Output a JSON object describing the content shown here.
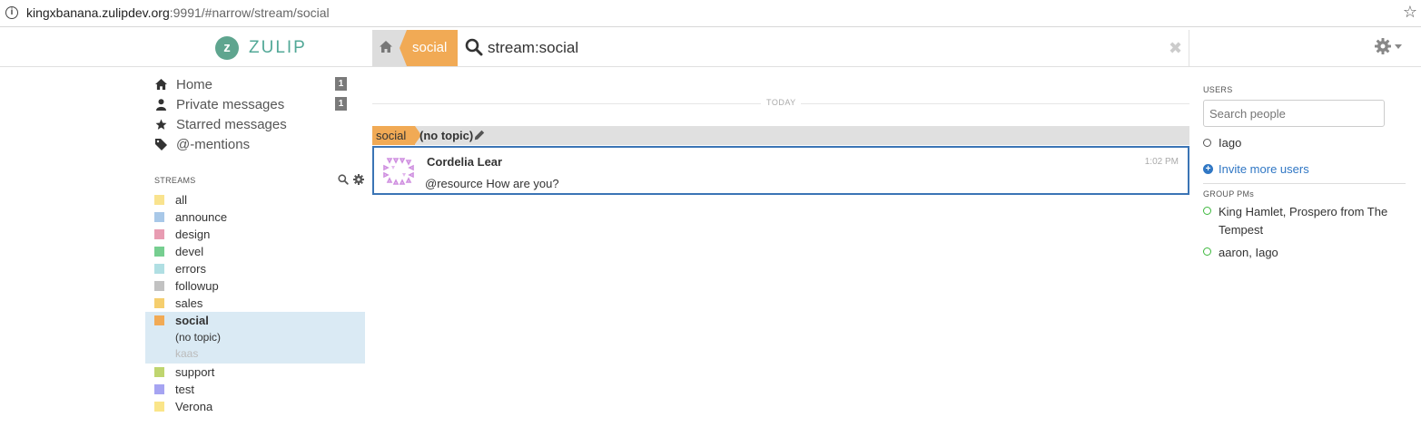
{
  "browser": {
    "url_host": "kingxbanana.zulipdev.org",
    "url_rest": ":9991/#narrow/stream/social"
  },
  "header": {
    "logo_letter": "z",
    "app_name": "ZULIP",
    "narrow_stream": "social",
    "search_query": "stream:social",
    "close_glyph": "✖"
  },
  "left_sidebar": {
    "nav": [
      {
        "label": "Home",
        "count": "1",
        "icon": "home-icon"
      },
      {
        "label": "Private messages",
        "count": "1",
        "icon": "user-icon"
      },
      {
        "label": "Starred messages",
        "icon": "star-icon"
      },
      {
        "label": "@-mentions",
        "icon": "tag-icon"
      }
    ],
    "streams_title": "STREAMS",
    "streams": [
      {
        "name": "all",
        "color": "#f9e38e"
      },
      {
        "name": "announce",
        "color": "#a8c8e8"
      },
      {
        "name": "design",
        "color": "#e89cb2"
      },
      {
        "name": "devel",
        "color": "#76ce90"
      },
      {
        "name": "errors",
        "color": "#b0dfe3"
      },
      {
        "name": "followup",
        "color": "#c2c2c2"
      },
      {
        "name": "sales",
        "color": "#f5ce6e"
      },
      {
        "name": "social",
        "color": "#f1aa55",
        "active": true,
        "topics": [
          "(no topic)",
          "kaas"
        ]
      },
      {
        "name": "support",
        "color": "#bfd56f"
      },
      {
        "name": "test",
        "color": "#a6a4f2"
      },
      {
        "name": "Verona",
        "color": "#fae589"
      }
    ]
  },
  "messages": {
    "date_label": "TODAY",
    "recipient": {
      "stream": "social",
      "topic": "(no topic)"
    },
    "items": [
      {
        "sender": "Cordelia Lear",
        "time": "1:02 PM",
        "content": "@resource How are you?"
      }
    ]
  },
  "right_sidebar": {
    "users_title": "USERS",
    "search_placeholder": "Search people",
    "users": [
      {
        "name": "Iago",
        "status": "offline"
      }
    ],
    "invite_label": "Invite more users",
    "group_pms_title": "GROUP PMs",
    "group_pms": [
      {
        "label": "King Hamlet, Prospero from The Tempest"
      },
      {
        "label": "aaron, Iago"
      }
    ]
  },
  "colors": {
    "accent_stream": "#f1aa55",
    "selected_message_border": "#3b74b5",
    "link": "#3077c4",
    "active_stream_bg": "#daeaf4",
    "logo": "#52a897"
  }
}
